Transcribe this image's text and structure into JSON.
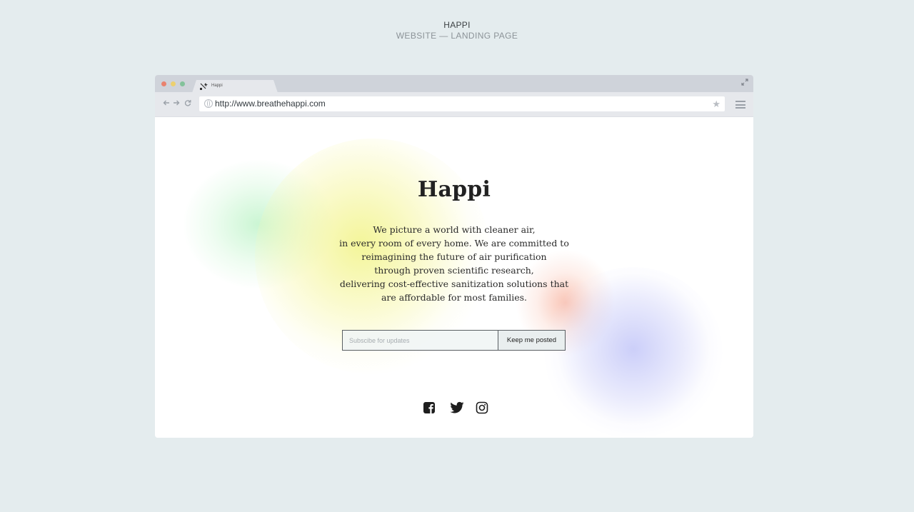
{
  "caption": {
    "title": "HAPPI",
    "subtitle": "WEBSITE — LANDING PAGE"
  },
  "browser": {
    "tab_title": "Happi",
    "url": "http://www.breathehappi.com",
    "icons": [
      "close-dot",
      "minimize-dot",
      "zoom-dot",
      "favicon",
      "expand-icon",
      "back-icon",
      "forward-icon",
      "reload-icon",
      "globe-icon",
      "star-icon",
      "menu-icon"
    ]
  },
  "hero": {
    "title": "Happi",
    "body_lines": [
      "We picture a world with cleaner air,",
      "in every room of every home. We are committed to",
      "reimagining the future of air purification",
      "through proven scientific research,",
      "delivering cost-effective sanitization solutions that",
      "are affordable for most families."
    ]
  },
  "subscribe": {
    "placeholder": "Subscibe for updates",
    "value": "",
    "button_label": "Keep me posted"
  },
  "social": [
    "facebook-icon",
    "twitter-icon",
    "instagram-icon"
  ],
  "colors": {
    "page_bg": "#e4ecee",
    "chrome_bg": "#cfd3da",
    "text_dark": "#222222",
    "blob_green": "#a0eeaf",
    "blob_yellow": "#f0f278",
    "blob_red": "#f6a087",
    "blob_blue": "#aaaff5"
  }
}
